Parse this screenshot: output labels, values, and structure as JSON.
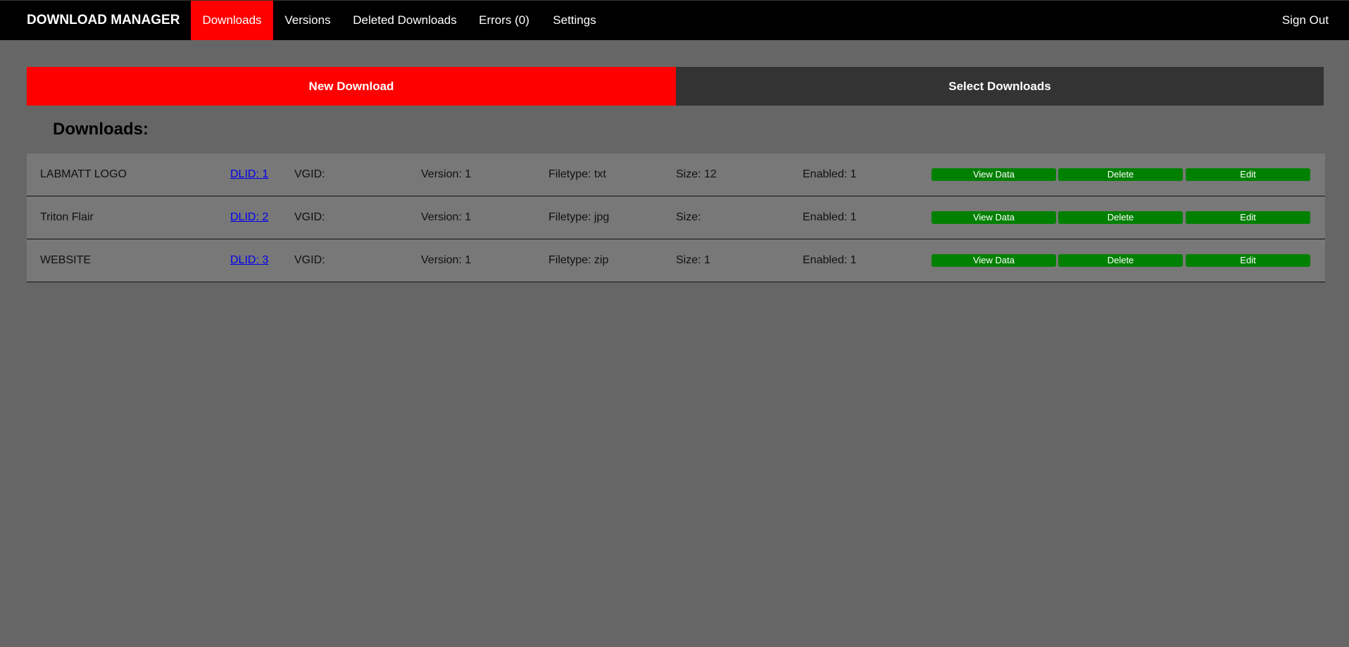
{
  "app": {
    "brand": "DOWNLOAD MANAGER"
  },
  "nav": {
    "downloads": "Downloads",
    "versions": "Versions",
    "deleted": "Deleted Downloads",
    "errors": "Errors (0)",
    "settings": "Settings",
    "signout": "Sign Out"
  },
  "actions": {
    "new_download": "New Download",
    "select_downloads": "Select Downloads"
  },
  "section": {
    "title": "Downloads:"
  },
  "buttons": {
    "view": "View Data",
    "delete": "Delete",
    "edit": "Edit"
  },
  "downloads": [
    {
      "name": "LABMATT LOGO",
      "dlid": "DLID: 1",
      "vgid": "VGID:",
      "version": "Version: 1",
      "filetype": "Filetype: txt",
      "size": "Size: 12",
      "enabled": "Enabled: 1"
    },
    {
      "name": "Triton Flair",
      "dlid": "DLID: 2",
      "vgid": "VGID:",
      "version": "Version: 1",
      "filetype": "Filetype: jpg",
      "size": "Size:",
      "enabled": "Enabled: 1"
    },
    {
      "name": "WEBSITE",
      "dlid": "DLID: 3",
      "vgid": "VGID:",
      "version": "Version: 1",
      "filetype": "Filetype: zip",
      "size": "Size: 1",
      "enabled": "Enabled: 1"
    }
  ],
  "colors": {
    "accent": "#ff0000",
    "navbar": "#000000",
    "background": "#666666",
    "row": "#787878",
    "button_green": "#008000",
    "link": "#0000ee"
  }
}
